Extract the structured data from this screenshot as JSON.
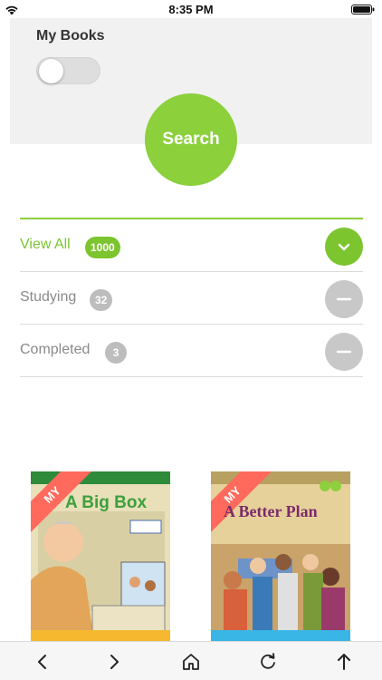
{
  "status_bar": {
    "time": "8:35 PM"
  },
  "filter_panel": {
    "my_books_label": "My Books",
    "my_books_toggle_on": false,
    "search_label": "Search"
  },
  "status_filters": [
    {
      "label": "View All",
      "count": "1000",
      "active": true,
      "icon": "chevron-down-icon"
    },
    {
      "label": "Studying",
      "count": "32",
      "active": false,
      "icon": "minus-icon"
    },
    {
      "label": "Completed",
      "count": "3",
      "active": false,
      "icon": "minus-icon"
    }
  ],
  "books": [
    {
      "ribbon": "MY",
      "title": "A Big Box",
      "strip_color": "#f5b82e"
    },
    {
      "ribbon": "MY",
      "title": "A Better Plan",
      "strip_color": "#39b6e6"
    }
  ],
  "toolbar": {
    "items": [
      "back-icon",
      "forward-icon",
      "home-icon",
      "refresh-icon",
      "share-icon"
    ]
  },
  "colors": {
    "accent": "#8cd03c",
    "ribbon": "#ff6a5c",
    "inactive": "#c8c8c8"
  }
}
